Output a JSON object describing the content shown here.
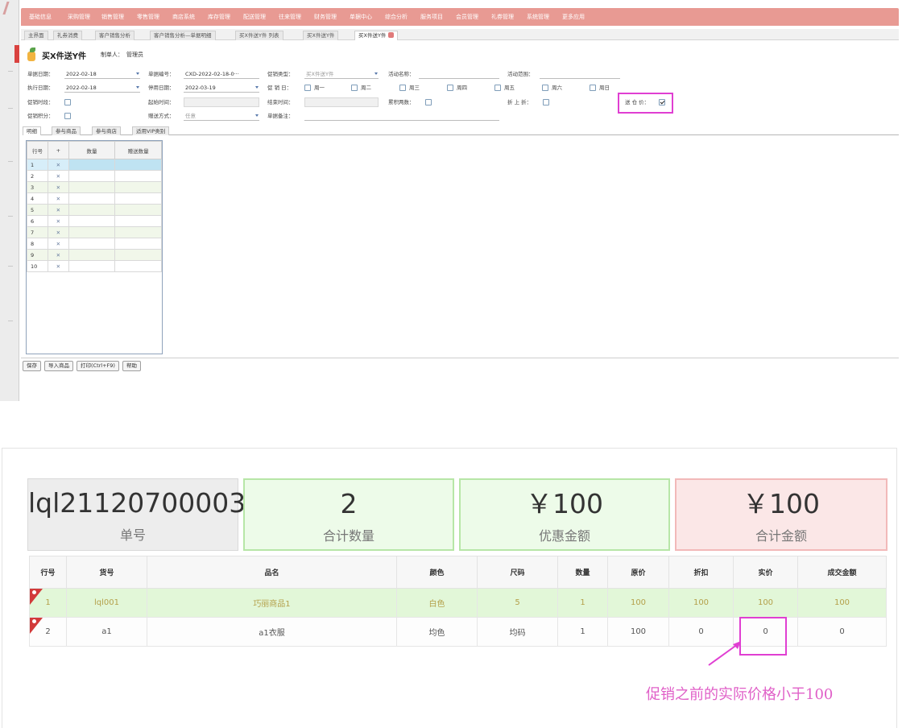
{
  "top": {
    "menu": [
      "基础信息",
      "采购管理",
      "销售管理",
      "零售管理",
      "商店系统",
      "库存管理",
      "配送管理",
      "往来管理",
      "财务管理",
      "单据中心",
      "综合分析",
      "服务项目",
      "会员管理",
      "礼券管理",
      "系统管理",
      "更多应用"
    ],
    "tabs": [
      "主界面",
      "礼券消费",
      "客户销售分析",
      "客户销售分析—单据明细",
      "买X件送Y件 列表",
      "买X件送Y件",
      "买X件送Y件"
    ],
    "active_tab_index": 6,
    "form": {
      "title": "买X件送Y件",
      "maker_label": "制单人：",
      "maker_value": "管理员",
      "fields": {
        "doc_date_label": "单据日期：",
        "doc_date": "2022-02-18",
        "doc_no_label": "单据编号：",
        "doc_no": "CXD-2022-02-18-0···",
        "promo_type_label": "促销类型：",
        "promo_type": "买X件送Y件",
        "activity_name_label": "活动名称：",
        "activity_scope_label": "活动范围：",
        "exec_date_label": "执行日期：",
        "exec_date": "2022-02-18",
        "stop_date_label": "停用日期：",
        "stop_date": "2022-03-19",
        "promo_day_label": "促 销 日：",
        "days": [
          "周一",
          "周二",
          "周三",
          "周四",
          "周五",
          "周六",
          "周日"
        ],
        "promo_period_label": "促销时段：",
        "start_time_label": "起始时间：",
        "end_time_label": "结束时间：",
        "cumulative_label": "累积两数：",
        "discount_on_discount_label": "折 上 折：",
        "gift_discount_label": "送 仓 价：",
        "promo_points_label": "促销积分：",
        "gift_method_label": "赠送方式：",
        "gift_method": "任意",
        "remark_label": "单据备注："
      }
    },
    "inner_tabs": [
      "明细",
      "参与商品",
      "参与商店",
      "适用VIP类别"
    ],
    "grid": {
      "headers": [
        "行号",
        "+",
        "数量",
        "赠送数量"
      ],
      "rows": [
        "1",
        "2",
        "3",
        "4",
        "5",
        "6",
        "7",
        "8",
        "9",
        "10"
      ],
      "plus_symbol": "✕"
    },
    "buttons": [
      "保存",
      "导入商品",
      "打印(Ctrl+F9)",
      "帮助"
    ]
  },
  "bottom": {
    "cards": [
      {
        "value": "lql21120700003",
        "label": "单号"
      },
      {
        "value": "2",
        "label": "合计数量"
      },
      {
        "value": "￥100",
        "label": "优惠金额"
      },
      {
        "value": "￥100",
        "label": "合计金额"
      }
    ],
    "table": {
      "headers": [
        "行号",
        "货号",
        "品名",
        "颜色",
        "尺码",
        "数量",
        "原价",
        "折扣",
        "实价",
        "成交金额"
      ],
      "rows": [
        [
          "1",
          "lql001",
          "巧丽商品1",
          "白色",
          "5",
          "1",
          "100",
          "100",
          "100",
          "100"
        ],
        [
          "2",
          "a1",
          "a1衣服",
          "均色",
          "均码",
          "1",
          "100",
          "0",
          "0",
          "0"
        ]
      ]
    },
    "annotation": "促销之前的实际价格小于100"
  },
  "colors": {
    "menubar": "#e89a93",
    "highlight": "#e03fd2",
    "annotation": "#e060c8",
    "row_green": "#e2f7d8",
    "flag": "#d23a3a"
  }
}
